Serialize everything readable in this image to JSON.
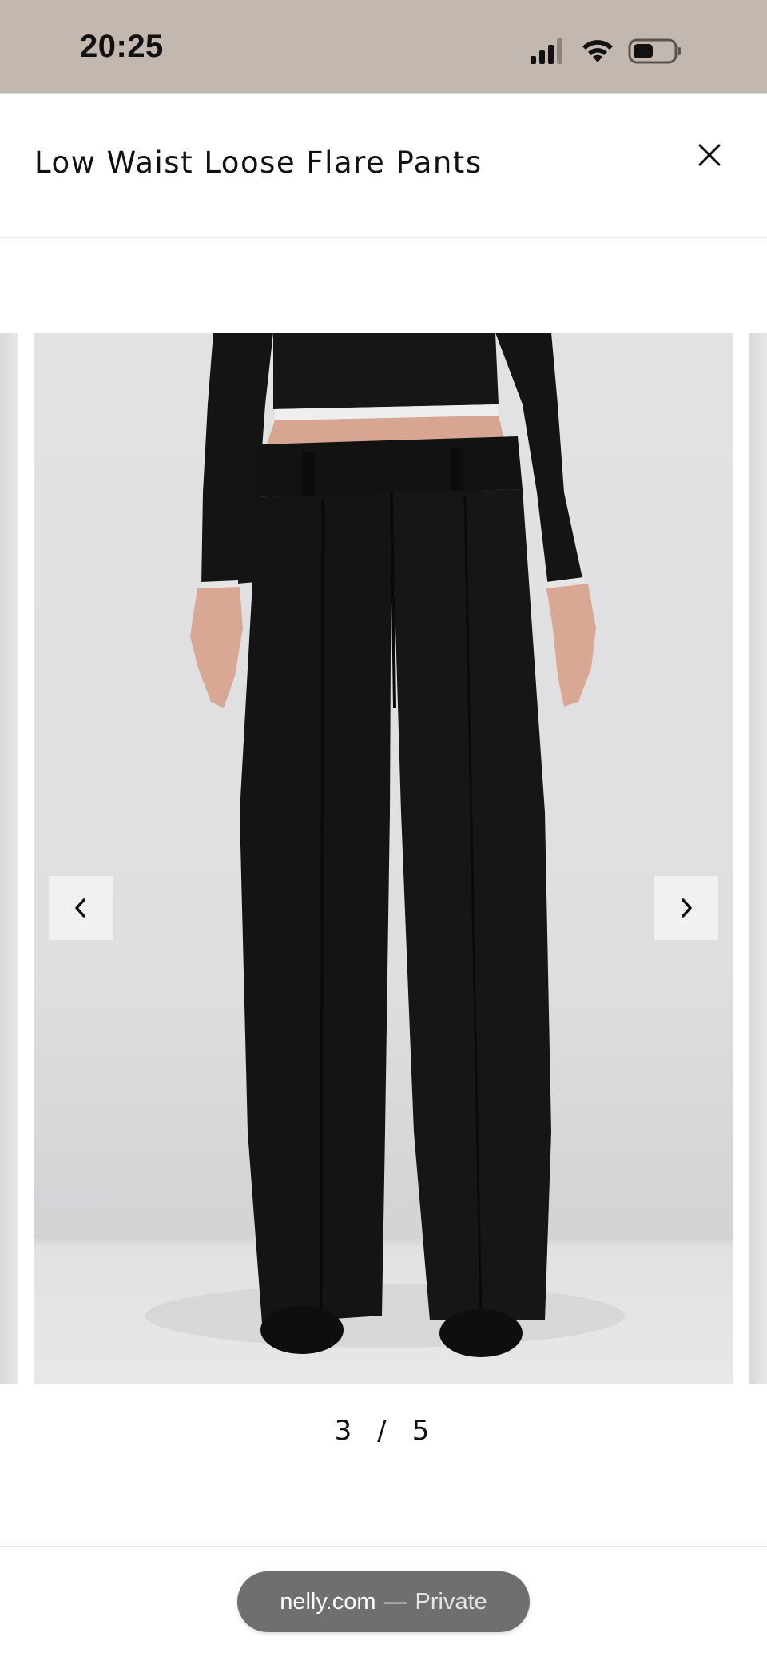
{
  "status_bar": {
    "time": "20:25",
    "icons": [
      "signal-icon",
      "wifi-icon",
      "battery-icon"
    ],
    "background": "#c3b8af"
  },
  "header": {
    "title": "Low Waist Loose Flare Pants",
    "close_icon": "close-icon"
  },
  "carousel": {
    "current": "3",
    "separator": "/",
    "total": "5",
    "prev_icon": "chevron-left-icon",
    "next_icon": "chevron-right-icon",
    "image_subject": "model wearing black low waist flare pants"
  },
  "browser": {
    "domain": "nelly.com",
    "separator": "—",
    "mode": "Private"
  }
}
